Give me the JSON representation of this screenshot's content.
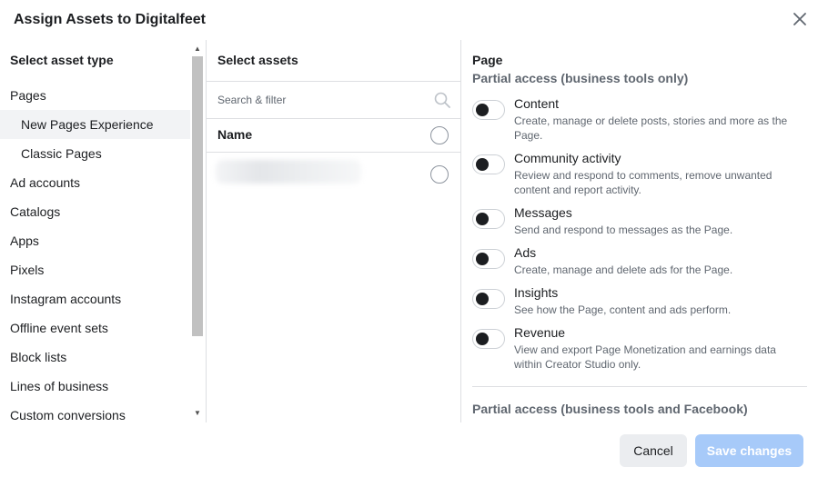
{
  "dialog": {
    "title": "Assign Assets to Digitalfeet"
  },
  "asset_types": {
    "heading": "Select asset type",
    "items": [
      {
        "label": "Pages",
        "sub": false,
        "selected": false
      },
      {
        "label": "New Pages Experience",
        "sub": true,
        "selected": true
      },
      {
        "label": "Classic Pages",
        "sub": true,
        "selected": false
      },
      {
        "label": "Ad accounts",
        "sub": false,
        "selected": false
      },
      {
        "label": "Catalogs",
        "sub": false,
        "selected": false
      },
      {
        "label": "Apps",
        "sub": false,
        "selected": false
      },
      {
        "label": "Pixels",
        "sub": false,
        "selected": false
      },
      {
        "label": "Instagram accounts",
        "sub": false,
        "selected": false
      },
      {
        "label": "Offline event sets",
        "sub": false,
        "selected": false
      },
      {
        "label": "Block lists",
        "sub": false,
        "selected": false
      },
      {
        "label": "Lines of business",
        "sub": false,
        "selected": false
      },
      {
        "label": "Custom conversions",
        "sub": false,
        "selected": false
      }
    ]
  },
  "assets": {
    "heading": "Select assets",
    "search_placeholder": "Search & filter",
    "name_header": "Name"
  },
  "permissions": {
    "heading": "Page",
    "group1": "Partial access (business tools only)",
    "items": [
      {
        "title": "Content",
        "desc": "Create, manage or delete posts, stories and more as the Page.",
        "enabled": false
      },
      {
        "title": "Community activity",
        "desc": "Review and respond to comments, remove unwanted content and report activity.",
        "enabled": false
      },
      {
        "title": "Messages",
        "desc": "Send and respond to messages as the Page.",
        "enabled": false
      },
      {
        "title": "Ads",
        "desc": "Create, manage and delete ads for the Page.",
        "enabled": false
      },
      {
        "title": "Insights",
        "desc": "See how the Page, content and ads perform.",
        "enabled": false
      },
      {
        "title": "Revenue",
        "desc": "View and export Page Monetization and earnings data within Creator Studio only.",
        "enabled": false
      }
    ],
    "group2": "Partial access (business tools and Facebook)"
  },
  "footer": {
    "cancel_label": "Cancel",
    "save_label": "Save changes"
  },
  "colors": {
    "save_disabled": "#a7caf9",
    "selected_row": "#f2f3f5"
  }
}
